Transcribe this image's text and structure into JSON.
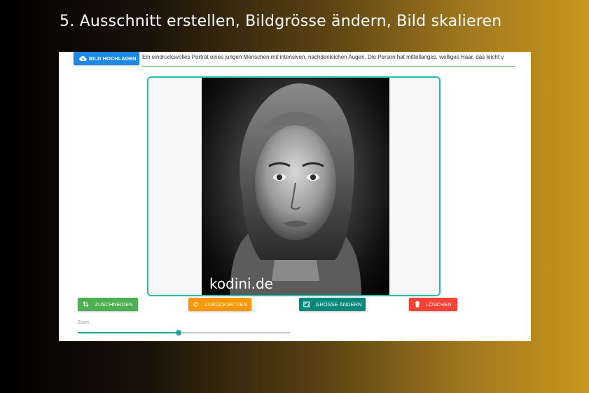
{
  "headline": "5. Ausschnitt erstellen, Bildgrösse ändern, Bild skalieren",
  "upload": {
    "label": "BILD HOCHLADEN",
    "icon": "cloud-upload-icon"
  },
  "description": {
    "value": "Ein eindrucksvolles Porträt eines jungen Menschen mit intensiven, nachdenklichen Augen. Die Person hat mittellanges, welliges Haar, das leicht v"
  },
  "image": {
    "watermark": "kodini.de",
    "content": "grayscale portrait photo"
  },
  "actions": {
    "crop": {
      "label": "ZUSCHNEIDEN",
      "icon": "crop-icon",
      "color": "#4caf50"
    },
    "reset": {
      "label": "ZURÜCKSETZEN",
      "icon": "refresh-icon",
      "color": "#ff9800"
    },
    "resize": {
      "label": "GRÖSSE ÄNDERN",
      "icon": "aspect-ratio-icon",
      "color": "#00897b"
    },
    "delete": {
      "label": "LÖSCHEN",
      "icon": "trash-icon",
      "color": "#f44336"
    }
  },
  "zoom": {
    "label": "Zoom",
    "level": 0.475
  },
  "colors": {
    "accent": "#26c0a8",
    "primary": "#1e88e5"
  }
}
